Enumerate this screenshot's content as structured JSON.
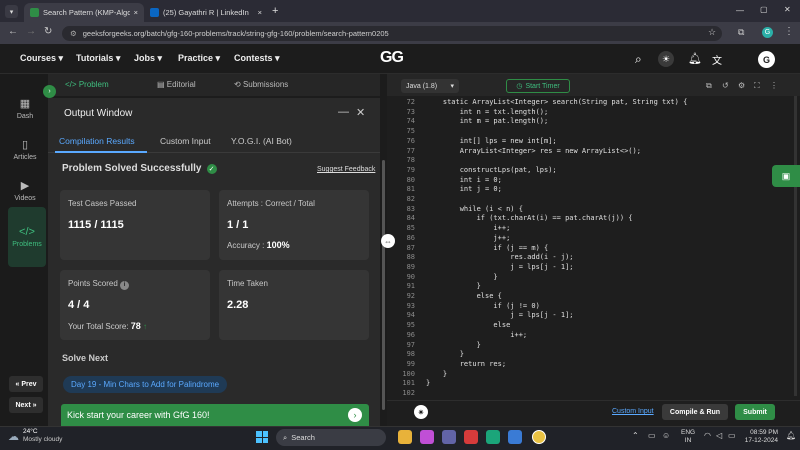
{
  "browser": {
    "tabs": [
      {
        "title": "Search Pattern (KMP-Algorithm",
        "close": "×"
      },
      {
        "title": "(25) Gayathri R | LinkedIn",
        "close": "×"
      }
    ],
    "new_tab": "+",
    "url": "geeksforgeeks.org/batch/gfg-160-problems/track/string-gfg-160/problem/search-pattern0205",
    "profile_badge": "G",
    "window_controls": [
      "—",
      "▢",
      "✕"
    ]
  },
  "site": {
    "nav": [
      "Courses",
      "Tutorials",
      "Jobs",
      "Practice",
      "Contests"
    ],
    "logo": "GG",
    "avatar": "G"
  },
  "sidebar": {
    "items": [
      {
        "label": "Dash"
      },
      {
        "label": "Articles"
      },
      {
        "label": "Videos"
      },
      {
        "label": "Problems"
      }
    ],
    "prev": "« Prev",
    "next": "Next »"
  },
  "panel_tabs": [
    "Problem",
    "Editorial",
    "Submissions"
  ],
  "output": {
    "title": "Output Window",
    "tabs": [
      "Compilation Results",
      "Custom Input",
      "Y.O.G.I. (AI Bot)"
    ],
    "status": "Problem Solved Successfully",
    "suggest": "Suggest Feedback",
    "tests_label": "Test Cases Passed",
    "tests_value": "1115 / 1115",
    "attempts_label": "Attempts : Correct / Total",
    "attempts_value": "1 / 1",
    "accuracy_label": "Accuracy :",
    "accuracy_value": "100%",
    "points_label": "Points Scored",
    "points_value": "4 / 4",
    "total_label": "Your Total Score:",
    "total_value": "78",
    "time_label": "Time Taken",
    "time_value": "2.28",
    "solve_next": "Solve Next",
    "next_problem": "Day 19 - Min Chars to Add for Palindrome",
    "banner": "Kick start your career with GfG 160!"
  },
  "editor": {
    "language": "Java (1.8)",
    "timer": "Start Timer",
    "lines": [
      {
        "n": "72",
        "t": "    static ArrayList<Integer> search(String pat, String txt) {"
      },
      {
        "n": "73",
        "t": "        int n = txt.length();"
      },
      {
        "n": "74",
        "t": "        int m = pat.length();"
      },
      {
        "n": "75",
        "t": ""
      },
      {
        "n": "76",
        "t": "        int[] lps = new int[m];"
      },
      {
        "n": "77",
        "t": "        ArrayList<Integer> res = new ArrayList<>();"
      },
      {
        "n": "78",
        "t": ""
      },
      {
        "n": "79",
        "t": "        constructLps(pat, lps);"
      },
      {
        "n": "80",
        "t": "        int i = 0;"
      },
      {
        "n": "81",
        "t": "        int j = 0;"
      },
      {
        "n": "82",
        "t": ""
      },
      {
        "n": "83",
        "t": "        while (i < n) {"
      },
      {
        "n": "84",
        "t": "            if (txt.charAt(i) == pat.charAt(j)) {"
      },
      {
        "n": "85",
        "t": "                i++;"
      },
      {
        "n": "86",
        "t": "                j++;"
      },
      {
        "n": "87",
        "t": "                if (j == m) {"
      },
      {
        "n": "88",
        "t": "                    res.add(i - j);"
      },
      {
        "n": "89",
        "t": "                    j = lps[j - 1];"
      },
      {
        "n": "90",
        "t": "                }"
      },
      {
        "n": "91",
        "t": "            }"
      },
      {
        "n": "92",
        "t": "            else {"
      },
      {
        "n": "93",
        "t": "                if (j != 0)"
      },
      {
        "n": "94",
        "t": "                    j = lps[j - 1];"
      },
      {
        "n": "95",
        "t": "                else"
      },
      {
        "n": "96",
        "t": "                    i++;"
      },
      {
        "n": "97",
        "t": "            }"
      },
      {
        "n": "98",
        "t": "        }"
      },
      {
        "n": "99",
        "t": "        return res;"
      },
      {
        "n": "100",
        "t": "    }"
      },
      {
        "n": "101",
        "t": "}"
      },
      {
        "n": "102",
        "t": ""
      }
    ],
    "custom_input": "Custom Input",
    "compile": "Compile & Run",
    "submit": "Submit"
  },
  "taskbar": {
    "weather_temp": "24°C",
    "weather_desc": "Mostly cloudy",
    "search_placeholder": "Search",
    "lang1": "ENG",
    "lang2": "IN",
    "time": "08:59 PM",
    "date": "17-12-2024"
  },
  "colors": {
    "brand": "#2f8d46",
    "accent": "#3fbf7f"
  }
}
